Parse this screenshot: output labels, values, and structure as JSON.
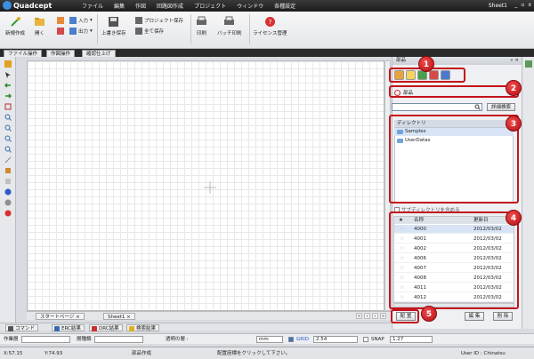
{
  "app": {
    "name": "Quadcept",
    "sheet": "Sheet1",
    "window_controls": [
      "_",
      "ğ",
      "x"
    ]
  },
  "menu": [
    "ファイル",
    "編集",
    "作図",
    "回路図作成",
    "プロジェクト",
    "ウィンドウ",
    "各種設定"
  ],
  "ribbon": {
    "new_label": "新規作成",
    "open_label": "開く",
    "input_label": "入力",
    "output_label": "出力",
    "save_overwrite_label": "上書き保存",
    "save_project_label": "プロジェクト保存",
    "save_all_label": "全て保存",
    "print_label": "印刷",
    "batch_print_label": "バッチ印刷",
    "license_label": "ライセンス管理"
  },
  "ribbon_tabs": [
    "ファイル操作",
    "作図操作",
    "確認仕上げ"
  ],
  "canvas_tabs": {
    "start_page": "スタートページ",
    "sheet1": "Sheet1",
    "close": "×"
  },
  "panel": {
    "title": "部品",
    "ctrls": "« ×",
    "parts_label": "部品",
    "search_placeholder": "",
    "advanced_search": "詳細検索",
    "directory_header": "ディレクトリ",
    "directories": [
      "Samples",
      "UserDatas"
    ],
    "include_subdirs": "サブディレクトリを含める",
    "columns": {
      "name": "名称",
      "updated": "更新日"
    },
    "parts": [
      {
        "name": "4000",
        "date": "2012/03/02"
      },
      {
        "name": "4001",
        "date": "2012/03/02"
      },
      {
        "name": "4002",
        "date": "2012/03/02"
      },
      {
        "name": "4006",
        "date": "2012/03/02"
      },
      {
        "name": "4007",
        "date": "2012/03/02"
      },
      {
        "name": "4008",
        "date": "2012/03/02"
      },
      {
        "name": "4011",
        "date": "2012/03/02"
      },
      {
        "name": "4012",
        "date": "2012/03/02"
      }
    ],
    "place_button": "配 置",
    "edit_button": "編 集",
    "delete_button": "削 除",
    "badges": [
      "1",
      "2",
      "3",
      "4",
      "5"
    ]
  },
  "bottom_tabs": [
    "コマンド",
    "ERC結果",
    "DRC結果",
    "検索結果"
  ],
  "propbar": {
    "layer_label": "作業層",
    "line_type_label": "層種類",
    "transparency_label": "透明の層 :",
    "unit": "mm",
    "grid_label": "GRID",
    "grid_value": "2.54",
    "snap_label": "SNAP",
    "snap_value": "1.27"
  },
  "status": {
    "x": "X:57.15",
    "y": "Y:74.93",
    "mode": "部品作成",
    "hint": "配置座標をクリックして下さい。",
    "user": "User ID : Chinatsu"
  },
  "colors": {
    "accent_red": "#c3141c",
    "title_bg": "#1b1b1b",
    "select_blue": "#d8e4f5"
  }
}
